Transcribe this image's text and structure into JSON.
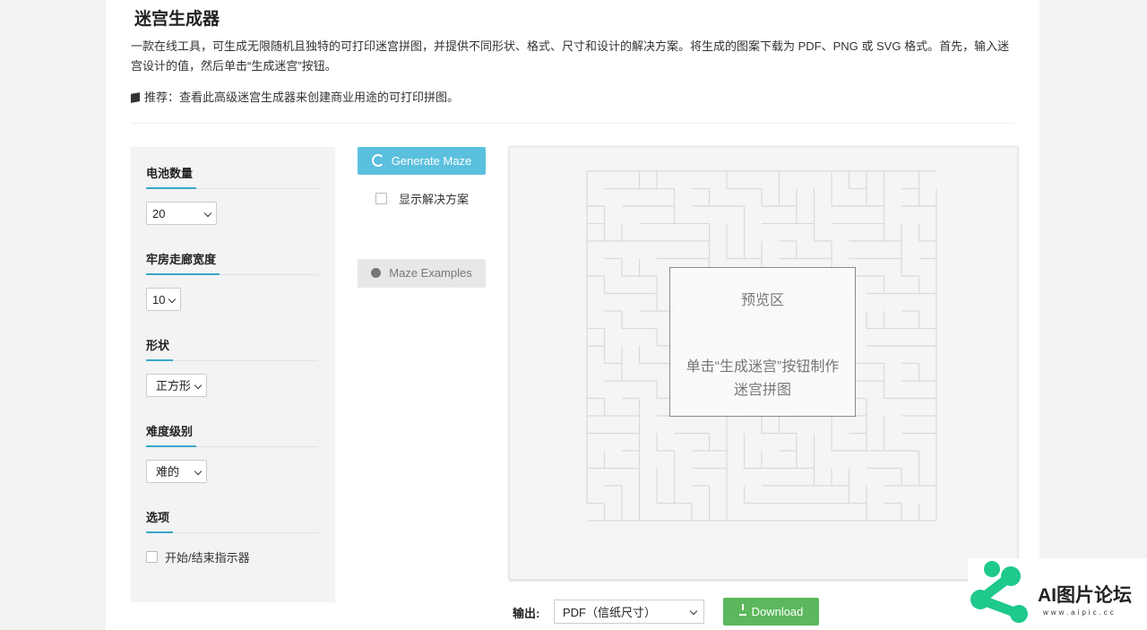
{
  "header": {
    "title": "迷宫生成器",
    "description": "一款在线工具，可生成无限随机且独特的可打印迷宫拼图，并提供不同形状、格式、尺寸和设计的解决方案。将生成的图案下载为 PDF、PNG 或 SVG 格式。首先，输入迷宫设计的值，然后单击“生成迷宫”按钮。",
    "tip": "推荐：查看此高级迷宫生成器来创建商业用途的可打印拼图。"
  },
  "sidebar": {
    "cells": {
      "label": "电池数量",
      "value": "20"
    },
    "corridor": {
      "label": "牢房走廊宽度",
      "value": "10"
    },
    "shape": {
      "label": "形状",
      "value": "正方形"
    },
    "difficulty": {
      "label": "难度级别",
      "value": "难的"
    },
    "options": {
      "label": "选项",
      "start_end_label": "开始/结束指示器",
      "start_end_checked": false
    }
  },
  "actions": {
    "generate_label": "Generate Maze",
    "show_solution_label": "显示解决方案",
    "show_solution_checked": false,
    "examples_label": "Maze Examples"
  },
  "preview": {
    "title": "预览区",
    "message": "单击“生成迷宫”按钮制作迷宫拼图"
  },
  "output": {
    "label": "输出:",
    "format_value": "PDF（信纸尺寸）",
    "download_label": "Download"
  },
  "watermark": {
    "text": "AI图片论坛",
    "url": "www.aipic.cc"
  },
  "colors": {
    "accent": "#3aa7c9",
    "generate_button": "#5bc0de",
    "download_button": "#5cb85c",
    "logo_green": "#1ec98b"
  }
}
